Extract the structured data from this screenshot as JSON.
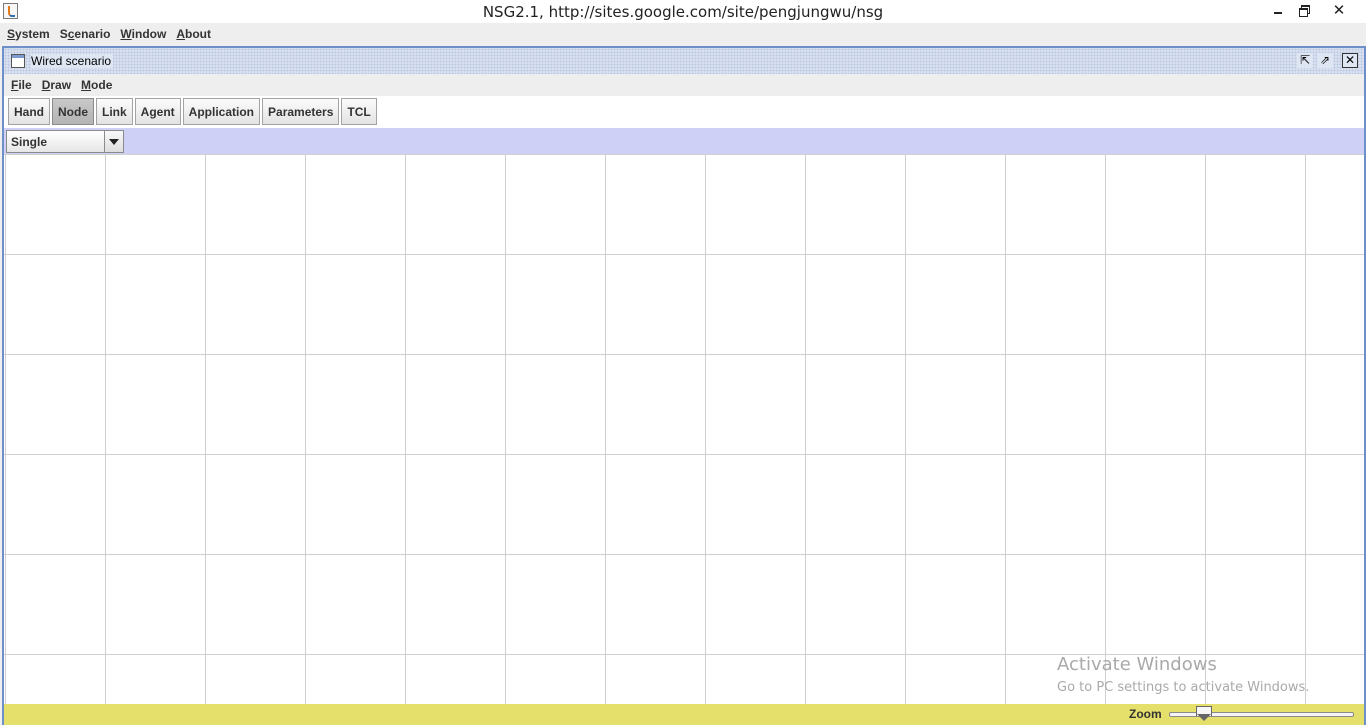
{
  "window": {
    "title": "NSG2.1, http://sites.google.com/site/pengjungwu/nsg",
    "close_glyph": "✕"
  },
  "app_menu": [
    {
      "label": "System",
      "ul": "S",
      "rest": "ystem"
    },
    {
      "label": "Scenario",
      "ul": "S",
      "rest": "cenario"
    },
    {
      "label": "Window",
      "ul": "W",
      "rest": "indow"
    },
    {
      "label": "About",
      "ul": "A",
      "rest": "bout"
    }
  ],
  "internal_frame": {
    "title": "Wired scenario",
    "controls": {
      "iconify": "⇱",
      "maximize": "⇗",
      "close": "✕"
    }
  },
  "scenario_menu": [
    {
      "label": "File",
      "ul": "F",
      "rest": "ile"
    },
    {
      "label": "Draw",
      "ul": "D",
      "rest": "raw"
    },
    {
      "label": "Mode",
      "ul": "M",
      "rest": "ode"
    }
  ],
  "toolbar": {
    "buttons": [
      "Hand",
      "Node",
      "Link",
      "Agent",
      "Application",
      "Parameters",
      "TCL"
    ],
    "active": "Node"
  },
  "node_mode": {
    "selected": "Single"
  },
  "watermark": {
    "title": "Activate Windows",
    "subtitle": "Go to PC settings to activate Windows."
  },
  "statusbar": {
    "zoom_label": "Zoom",
    "zoom_level": 0.2
  },
  "colors": {
    "frame_border": "#6e8fc8",
    "select_bar": "#cfd0f5",
    "status_bar": "#e5df6b",
    "grid": "#cfcfcf"
  }
}
